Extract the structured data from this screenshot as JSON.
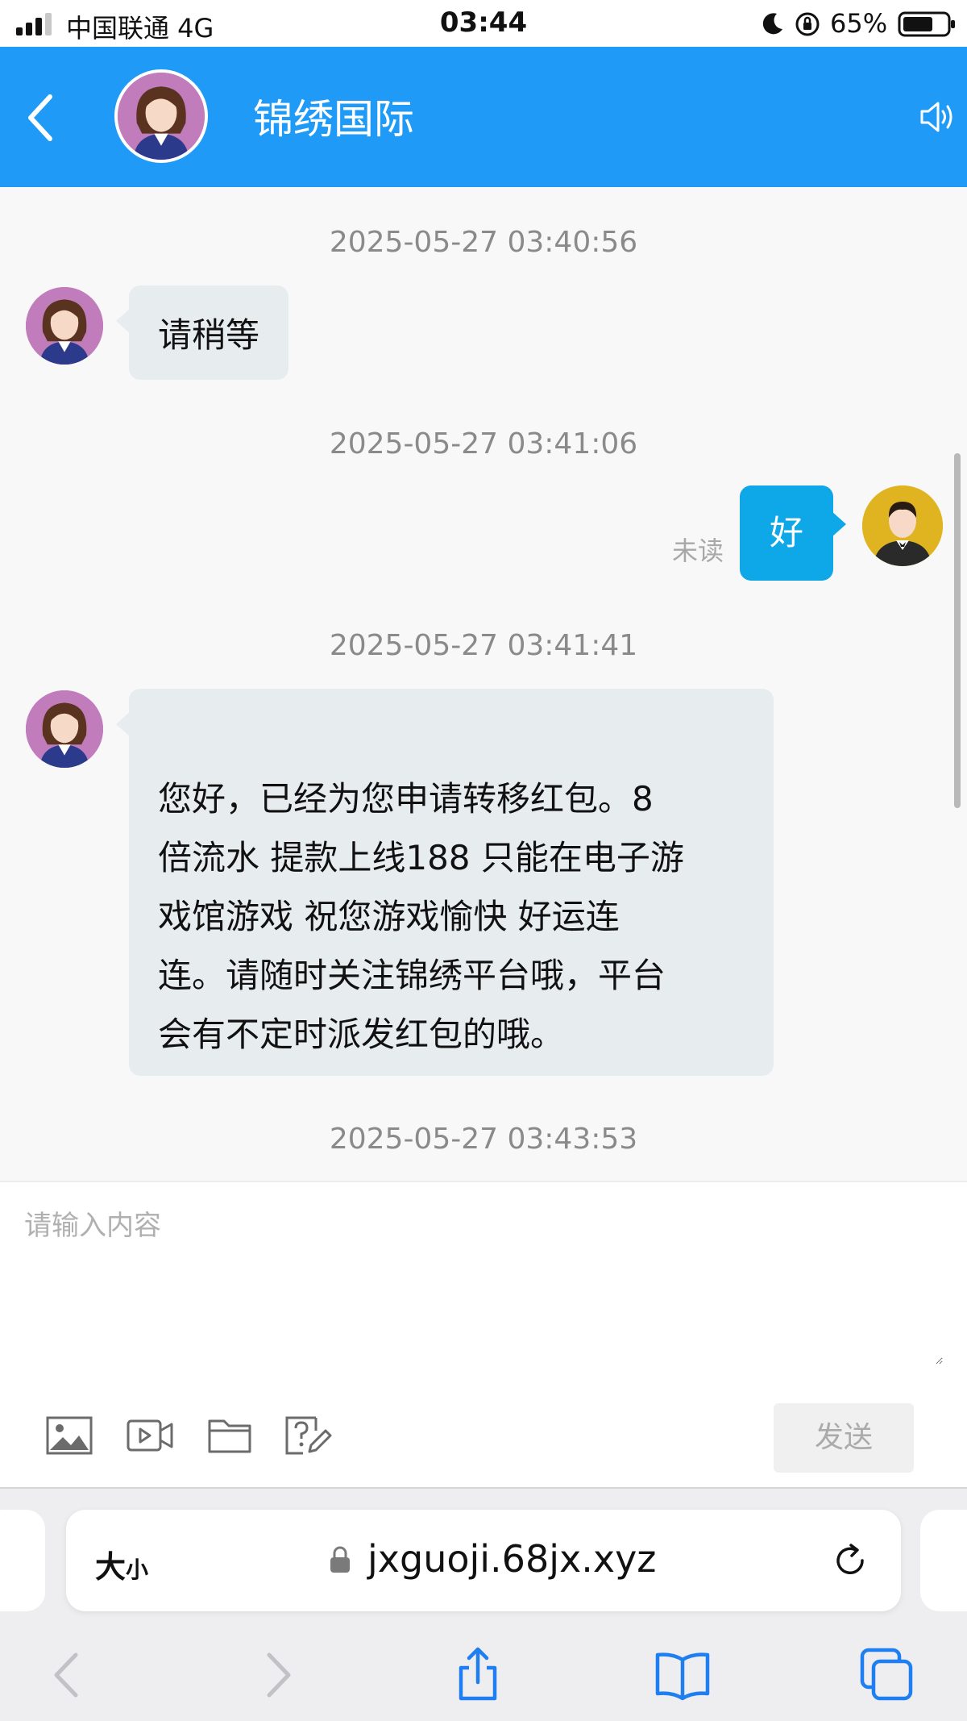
{
  "status_bar": {
    "carrier": "中国联通  4G",
    "time": "03:44",
    "battery": "65%"
  },
  "header": {
    "title": "锦绣国际",
    "icons": [
      "back-icon",
      "agent-avatar",
      "speaker-icon"
    ]
  },
  "messages": [
    {
      "type": "timestamp",
      "text": "2025-05-27 03:40:56"
    },
    {
      "type": "agent",
      "text": "请稍等"
    },
    {
      "type": "timestamp",
      "text": "2025-05-27 03:41:06"
    },
    {
      "type": "user",
      "text": "好",
      "status": "未读"
    },
    {
      "type": "timestamp",
      "text": "2025-05-27 03:41:41"
    },
    {
      "type": "agent",
      "lines": [
        "您好，已经为您申请转移红包。8",
        "倍流水 提款上线188 只能在电子游",
        "戏馆游戏 祝您游戏愉快 好运连",
        "连。请随时关注锦绣平台哦，平台",
        "会有不定时派发红包的哦。"
      ]
    },
    {
      "type": "timestamp",
      "text": "2025-05-27 03:43:53"
    }
  ],
  "composer": {
    "placeholder": "请输入内容",
    "send_label": "发送",
    "tools": [
      "image-icon",
      "video-icon",
      "folder-icon",
      "help-edit-icon"
    ]
  },
  "browser": {
    "text_size_big": "大",
    "text_size_small": "小",
    "url": "jxguoji.68jx.xyz",
    "nav": [
      "back-arrow-icon",
      "forward-arrow-icon",
      "share-icon",
      "bookmarks-icon",
      "tabs-icon"
    ]
  },
  "colors": {
    "header": "#1f9bf7",
    "user_bubble": "#0ea7e8",
    "agent_bubble": "#e7ecee"
  }
}
